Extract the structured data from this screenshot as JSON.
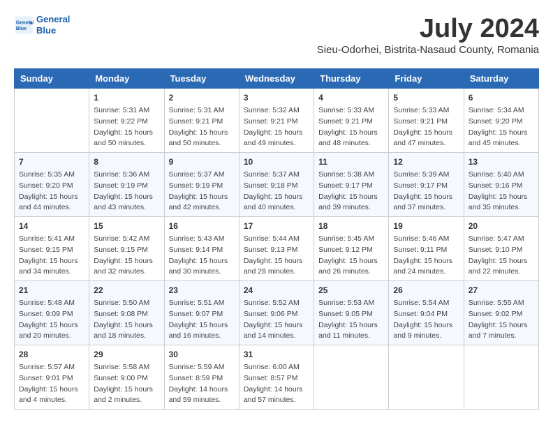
{
  "header": {
    "logo_line1": "General",
    "logo_line2": "Blue",
    "month_year": "July 2024",
    "location": "Sieu-Odorhei, Bistrita-Nasaud County, Romania"
  },
  "weekdays": [
    "Sunday",
    "Monday",
    "Tuesday",
    "Wednesday",
    "Thursday",
    "Friday",
    "Saturday"
  ],
  "weeks": [
    [
      {
        "day": "",
        "info": ""
      },
      {
        "day": "1",
        "info": "Sunrise: 5:31 AM\nSunset: 9:22 PM\nDaylight: 15 hours\nand 50 minutes."
      },
      {
        "day": "2",
        "info": "Sunrise: 5:31 AM\nSunset: 9:21 PM\nDaylight: 15 hours\nand 50 minutes."
      },
      {
        "day": "3",
        "info": "Sunrise: 5:32 AM\nSunset: 9:21 PM\nDaylight: 15 hours\nand 49 minutes."
      },
      {
        "day": "4",
        "info": "Sunrise: 5:33 AM\nSunset: 9:21 PM\nDaylight: 15 hours\nand 48 minutes."
      },
      {
        "day": "5",
        "info": "Sunrise: 5:33 AM\nSunset: 9:21 PM\nDaylight: 15 hours\nand 47 minutes."
      },
      {
        "day": "6",
        "info": "Sunrise: 5:34 AM\nSunset: 9:20 PM\nDaylight: 15 hours\nand 45 minutes."
      }
    ],
    [
      {
        "day": "7",
        "info": "Sunrise: 5:35 AM\nSunset: 9:20 PM\nDaylight: 15 hours\nand 44 minutes."
      },
      {
        "day": "8",
        "info": "Sunrise: 5:36 AM\nSunset: 9:19 PM\nDaylight: 15 hours\nand 43 minutes."
      },
      {
        "day": "9",
        "info": "Sunrise: 5:37 AM\nSunset: 9:19 PM\nDaylight: 15 hours\nand 42 minutes."
      },
      {
        "day": "10",
        "info": "Sunrise: 5:37 AM\nSunset: 9:18 PM\nDaylight: 15 hours\nand 40 minutes."
      },
      {
        "day": "11",
        "info": "Sunrise: 5:38 AM\nSunset: 9:17 PM\nDaylight: 15 hours\nand 39 minutes."
      },
      {
        "day": "12",
        "info": "Sunrise: 5:39 AM\nSunset: 9:17 PM\nDaylight: 15 hours\nand 37 minutes."
      },
      {
        "day": "13",
        "info": "Sunrise: 5:40 AM\nSunset: 9:16 PM\nDaylight: 15 hours\nand 35 minutes."
      }
    ],
    [
      {
        "day": "14",
        "info": "Sunrise: 5:41 AM\nSunset: 9:15 PM\nDaylight: 15 hours\nand 34 minutes."
      },
      {
        "day": "15",
        "info": "Sunrise: 5:42 AM\nSunset: 9:15 PM\nDaylight: 15 hours\nand 32 minutes."
      },
      {
        "day": "16",
        "info": "Sunrise: 5:43 AM\nSunset: 9:14 PM\nDaylight: 15 hours\nand 30 minutes."
      },
      {
        "day": "17",
        "info": "Sunrise: 5:44 AM\nSunset: 9:13 PM\nDaylight: 15 hours\nand 28 minutes."
      },
      {
        "day": "18",
        "info": "Sunrise: 5:45 AM\nSunset: 9:12 PM\nDaylight: 15 hours\nand 26 minutes."
      },
      {
        "day": "19",
        "info": "Sunrise: 5:46 AM\nSunset: 9:11 PM\nDaylight: 15 hours\nand 24 minutes."
      },
      {
        "day": "20",
        "info": "Sunrise: 5:47 AM\nSunset: 9:10 PM\nDaylight: 15 hours\nand 22 minutes."
      }
    ],
    [
      {
        "day": "21",
        "info": "Sunrise: 5:48 AM\nSunset: 9:09 PM\nDaylight: 15 hours\nand 20 minutes."
      },
      {
        "day": "22",
        "info": "Sunrise: 5:50 AM\nSunset: 9:08 PM\nDaylight: 15 hours\nand 18 minutes."
      },
      {
        "day": "23",
        "info": "Sunrise: 5:51 AM\nSunset: 9:07 PM\nDaylight: 15 hours\nand 16 minutes."
      },
      {
        "day": "24",
        "info": "Sunrise: 5:52 AM\nSunset: 9:06 PM\nDaylight: 15 hours\nand 14 minutes."
      },
      {
        "day": "25",
        "info": "Sunrise: 5:53 AM\nSunset: 9:05 PM\nDaylight: 15 hours\nand 11 minutes."
      },
      {
        "day": "26",
        "info": "Sunrise: 5:54 AM\nSunset: 9:04 PM\nDaylight: 15 hours\nand 9 minutes."
      },
      {
        "day": "27",
        "info": "Sunrise: 5:55 AM\nSunset: 9:02 PM\nDaylight: 15 hours\nand 7 minutes."
      }
    ],
    [
      {
        "day": "28",
        "info": "Sunrise: 5:57 AM\nSunset: 9:01 PM\nDaylight: 15 hours\nand 4 minutes."
      },
      {
        "day": "29",
        "info": "Sunrise: 5:58 AM\nSunset: 9:00 PM\nDaylight: 15 hours\nand 2 minutes."
      },
      {
        "day": "30",
        "info": "Sunrise: 5:59 AM\nSunset: 8:59 PM\nDaylight: 14 hours\nand 59 minutes."
      },
      {
        "day": "31",
        "info": "Sunrise: 6:00 AM\nSunset: 8:57 PM\nDaylight: 14 hours\nand 57 minutes."
      },
      {
        "day": "",
        "info": ""
      },
      {
        "day": "",
        "info": ""
      },
      {
        "day": "",
        "info": ""
      }
    ]
  ]
}
